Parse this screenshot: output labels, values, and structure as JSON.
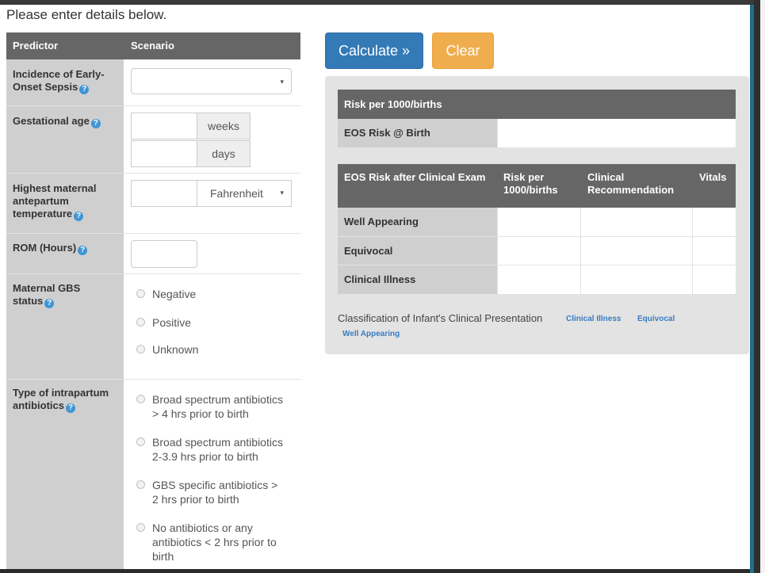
{
  "intro_text": "Please enter details below.",
  "form": {
    "headers": {
      "predictor": "Predictor",
      "scenario": "Scenario"
    },
    "help_glyph": "?",
    "caret_glyph": "▾",
    "incidence": {
      "label": "Incidence of Early-Onset Sepsis",
      "value": ""
    },
    "gestational_age": {
      "label": "Gestational age",
      "weeks_unit": "weeks",
      "days_unit": "days",
      "weeks_value": "",
      "days_value": ""
    },
    "temperature": {
      "label": "Highest maternal antepartum temperature",
      "unit": "Fahrenheit",
      "value": ""
    },
    "rom": {
      "label": "ROM (Hours)",
      "value": ""
    },
    "gbs": {
      "label": "Maternal GBS status",
      "options": [
        "Negative",
        "Positive",
        "Unknown"
      ]
    },
    "antibiotics": {
      "label": "Type of intrapartum antibiotics",
      "options": [
        "Broad spectrum antibiotics > 4 hrs prior to birth",
        "Broad spectrum antibiotics 2-3.9 hrs prior to birth",
        "GBS specific antibiotics > 2 hrs prior to birth",
        "No antibiotics or any antibiotics < 2 hrs prior to birth"
      ]
    }
  },
  "buttons": {
    "calculate": "Calculate »",
    "clear": "Clear"
  },
  "results": {
    "risk_table": {
      "header": "Risk per 1000/births",
      "row_label": "EOS Risk @ Birth",
      "row_value": ""
    },
    "exam_table": {
      "headers": [
        "EOS Risk after Clinical Exam",
        "Risk per 1000/births",
        "Clinical Recommendation",
        "Vitals"
      ],
      "rows": [
        "Well Appearing",
        "Equivocal",
        "Clinical Illness"
      ]
    },
    "classification": {
      "label": "Classification of Infant's Clinical Presentation",
      "links": [
        "Clinical Illness",
        "Equivocal",
        "Well Appearing"
      ]
    }
  },
  "colors": {
    "header_gray": "#666666",
    "label_gray": "#cfcfcf",
    "calculate_blue": "#337ab7",
    "clear_orange": "#f0ad4e",
    "link_blue": "#3a7cc1",
    "help_blue": "#3e95d6"
  }
}
